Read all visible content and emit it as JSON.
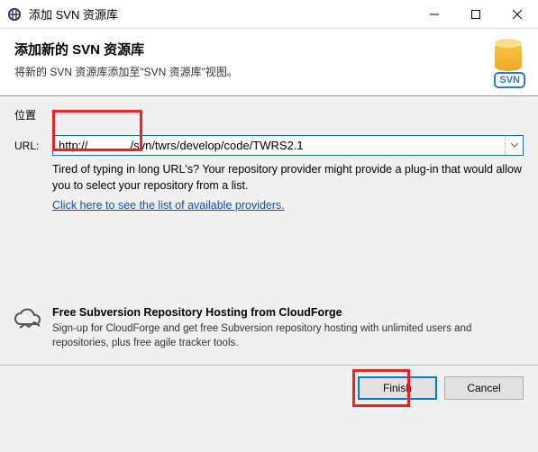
{
  "window": {
    "title": "添加 SVN 资源库"
  },
  "header": {
    "title": "添加新的 SVN 资源库",
    "description": "将新的 SVN 资源库添加至\"SVN 资源库\"视图。",
    "badge": "SVN"
  },
  "location": {
    "legend": "位置",
    "url_label": "URL:",
    "url_value": "http://             /svn/twrs/develop/code/TWRS2.1",
    "hint": "Tired of typing in long URL's?  Your repository provider might provide a plug-in that would allow you to select your repository from a list.",
    "link_text": "Click here to see the list of available providers."
  },
  "promo": {
    "title": "Free Subversion Repository Hosting from CloudForge",
    "body": "Sign-up for CloudForge and get free Subversion repository hosting with unlimited users and repositories, plus free agile tracker tools."
  },
  "buttons": {
    "finish": "Finish",
    "cancel": "Cancel"
  }
}
